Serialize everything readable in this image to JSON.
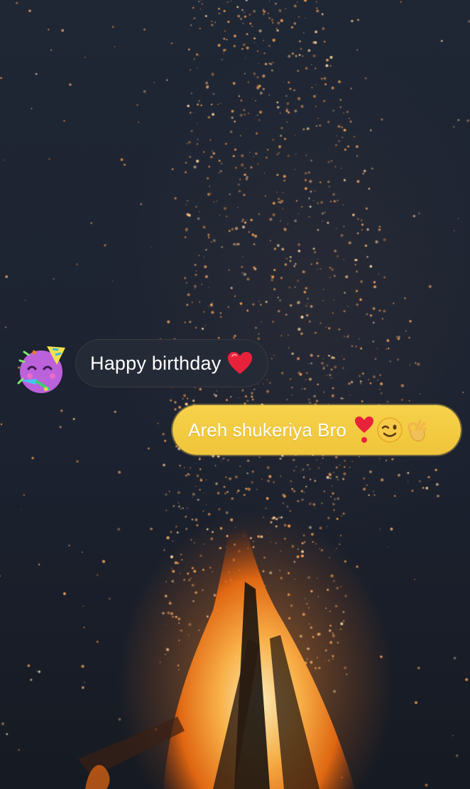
{
  "chat": {
    "incoming": {
      "avatar": "party-face-icon",
      "text": "Happy birthday",
      "emoji": "red-heart-icon"
    },
    "outgoing": {
      "text": "Areh shukeriya Bro",
      "emojis": [
        "heart-exclamation-icon",
        "winking-face-icon",
        "ok-hand-icon"
      ]
    }
  },
  "colors": {
    "background": "#1d2431",
    "incoming_bubble": "#252b36",
    "outgoing_bubble": "#f0c43a",
    "text": "#ffffff",
    "heart": "#e8223a",
    "sparks": "#f3a35c",
    "fire": "#ff8a2a"
  }
}
